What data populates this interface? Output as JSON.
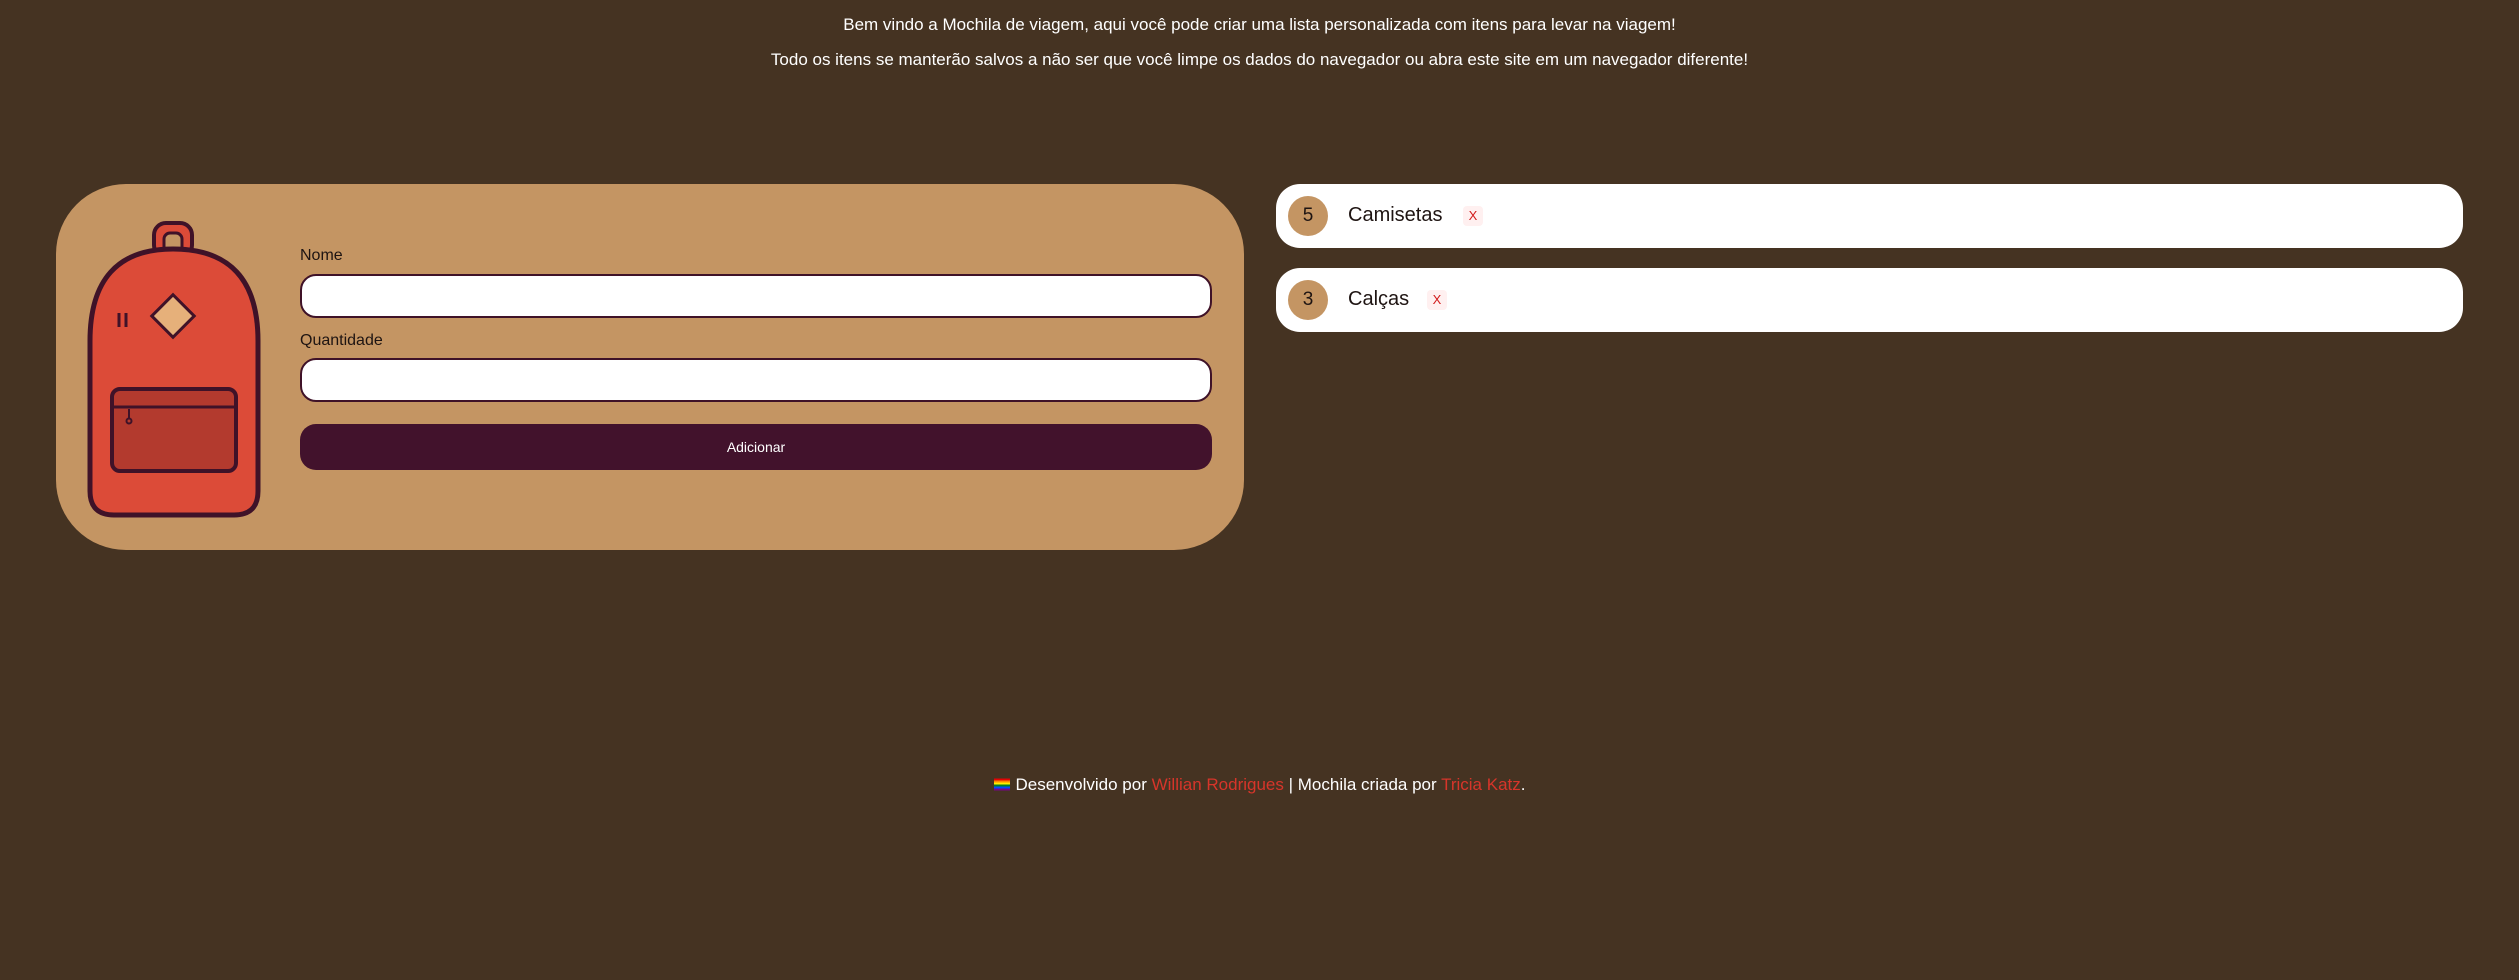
{
  "intro": {
    "line1": "Bem vindo a Mochila de viagem, aqui você pode criar uma lista personalizada com itens para levar na viagem!",
    "line2": "Todo os itens se manterão salvos a não ser que você limpe os dados do navegador ou abra este site em um navegador diferente!"
  },
  "form": {
    "name_label": "Nome",
    "name_value": "",
    "quantity_label": "Quantidade",
    "quantity_value": "",
    "submit_label": "Adicionar"
  },
  "items": [
    {
      "quantity": "5",
      "name": "Camisetas",
      "remove_label": "X"
    },
    {
      "quantity": "3",
      "name": "Calças",
      "remove_label": "X"
    }
  ],
  "footer": {
    "flag_icon": "rainbow-flag-icon",
    "dev_prefix": "Desenvolvido por",
    "dev_name": "Willian Rodrigues",
    "separator": "| Mochila criada por",
    "artist_name": "Tricia Katz",
    "end": "."
  },
  "colors": {
    "background": "#453322",
    "card": "#c49563",
    "button": "#42122c",
    "link": "#d7352a",
    "backpack": "#dc4b38"
  }
}
